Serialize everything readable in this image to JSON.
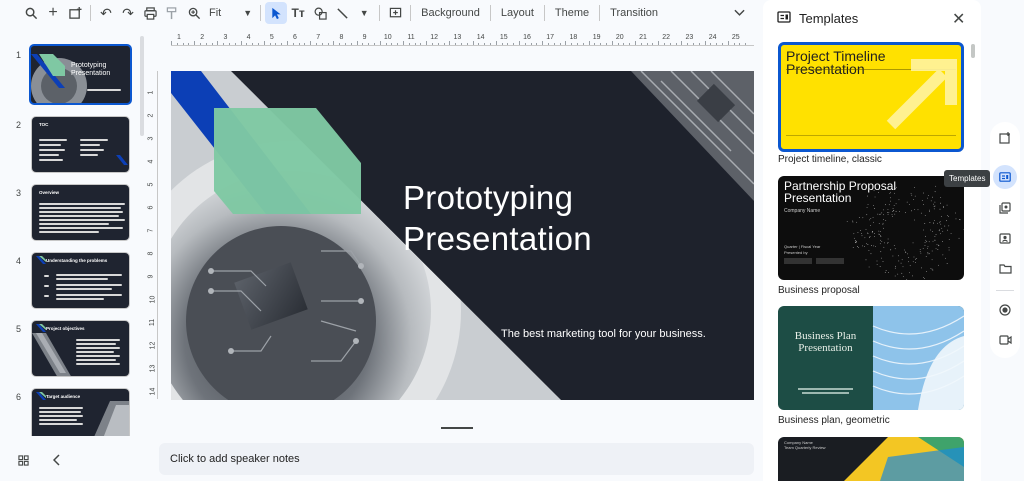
{
  "toolbar": {
    "zoom": "Fit",
    "background_label": "Background",
    "layout_label": "Layout",
    "theme_label": "Theme",
    "transition_label": "Transition"
  },
  "ruler": {
    "marks": [
      "1",
      "2",
      "3",
      "4",
      "5",
      "6",
      "7",
      "8",
      "9",
      "10",
      "11",
      "12",
      "13",
      "14",
      "15",
      "16",
      "17",
      "18",
      "19",
      "20",
      "21",
      "22",
      "23",
      "24",
      "25"
    ],
    "vmarks": [
      "1",
      "2",
      "3",
      "4",
      "5",
      "6",
      "7",
      "8",
      "9",
      "10",
      "11",
      "12",
      "13",
      "14"
    ]
  },
  "filmstrip": {
    "slides": [
      {
        "number": "1",
        "title": "Prototyping Presentation"
      },
      {
        "number": "2",
        "title": "TOC"
      },
      {
        "number": "3",
        "title": "Overview"
      },
      {
        "number": "4",
        "title": "Understanding the problems"
      },
      {
        "number": "5",
        "title": "Project objectives"
      },
      {
        "number": "6",
        "title": "Target audience"
      }
    ]
  },
  "slide": {
    "title_line1": "Prototyping",
    "title_line2": "Presentation",
    "subtitle": "The best marketing tool for your business."
  },
  "notes": {
    "placeholder": "Click to add speaker notes"
  },
  "templates_panel": {
    "title": "Templates",
    "templates": [
      {
        "label": "Project timeline, classic",
        "preview_title_line1": "Project Timeline",
        "preview_title_line2": "Presentation"
      },
      {
        "label": "Business proposal",
        "preview_title_line1": "Partnership Proposal",
        "preview_title_line2": "Presentation",
        "preview_sub": "Company Name",
        "preview_meta1": "Quarter  |  Fiscal Year",
        "preview_meta2": "Presented by"
      },
      {
        "label": "Business plan, geometric",
        "preview_title_line1": "Business Plan",
        "preview_title_line2": "Presentation"
      },
      {
        "label": "",
        "preview_title_line1": "Company Name",
        "preview_title_line2": "Team Quarterly Review"
      }
    ]
  },
  "tooltip": "Templates",
  "colors": {
    "accent": "#0b57d0",
    "slide_bg": "#1e222c",
    "slide_blue": "#0c3fb6",
    "slide_green": "#7fc8a3",
    "template_yellow": "#ffe100"
  }
}
